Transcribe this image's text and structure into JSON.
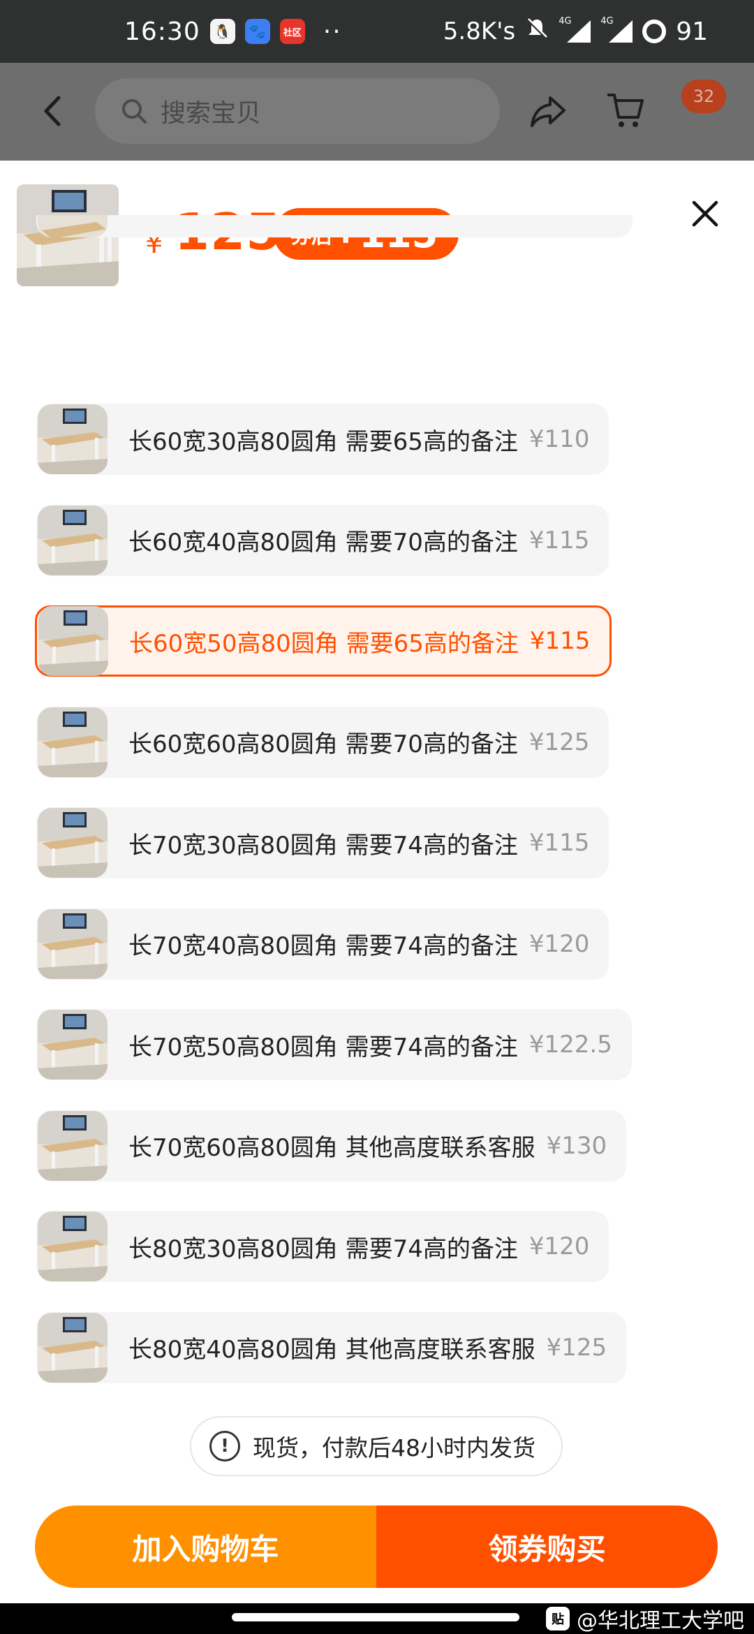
{
  "status_bar": {
    "time": "16:30",
    "app_icons": [
      "qq-icon",
      "baidu-icon",
      "community-icon"
    ],
    "community_icon_text": "社区",
    "more_dots": "··",
    "net_speed": "5.8K's",
    "signal_label_1": "4G",
    "signal_label_2": "4G",
    "battery": "91"
  },
  "header": {
    "search_placeholder": "搜索宝贝",
    "cart_badge": "32"
  },
  "product": {
    "price_symbol": "¥",
    "price": "125",
    "coupon_label": "券后",
    "coupon_symbol": "¥",
    "coupon_price": "115"
  },
  "options": [
    {
      "name": "长60宽30高80圆角 需要65高的备注",
      "price": "¥110",
      "selected": false
    },
    {
      "name": "长60宽40高80圆角 需要70高的备注",
      "price": "¥115",
      "selected": false
    },
    {
      "name": "长60宽50高80圆角 需要65高的备注",
      "price": "¥115",
      "selected": true
    },
    {
      "name": "长60宽60高80圆角 需要70高的备注",
      "price": "¥125",
      "selected": false
    },
    {
      "name": "长70宽30高80圆角 需要74高的备注",
      "price": "¥115",
      "selected": false
    },
    {
      "name": "长70宽40高80圆角 需要74高的备注",
      "price": "¥120",
      "selected": false
    },
    {
      "name": "长70宽50高80圆角 需要74高的备注",
      "price": "¥122.5",
      "selected": false
    },
    {
      "name": "长70宽60高80圆角 其他高度联系客服",
      "price": "¥130",
      "selected": false
    },
    {
      "name": "长80宽30高80圆角 需要74高的备注",
      "price": "¥120",
      "selected": false
    },
    {
      "name": "长80宽40高80圆角 其他高度联系客服",
      "price": "¥125",
      "selected": false
    }
  ],
  "stock_notice": "现货，付款后48小时内发货",
  "buttons": {
    "add_to_cart": "加入购物车",
    "buy_with_coupon": "领券购买"
  },
  "watermark": {
    "logo": "贴",
    "text": "@华北理工大学吧"
  },
  "colors": {
    "accent": "#ff5000",
    "cart_button": "#ff9000",
    "option_bg": "#f5f5f5",
    "muted_price": "#9a9a9a"
  }
}
